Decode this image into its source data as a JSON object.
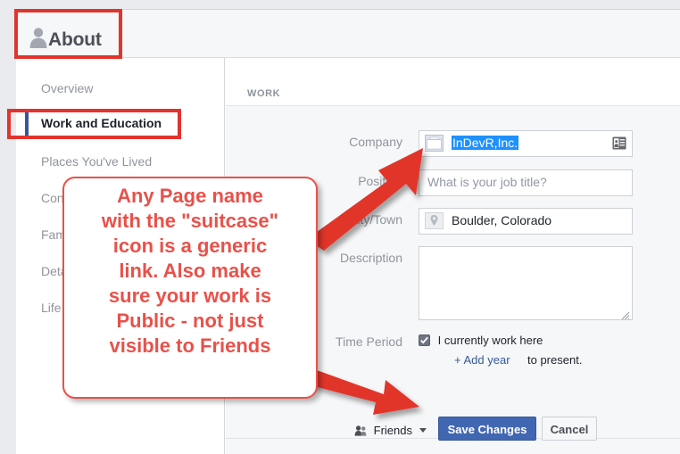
{
  "header": {
    "title": "About",
    "person_icon": "person-icon"
  },
  "sidebar": {
    "items": [
      {
        "label": "Overview",
        "active": false
      },
      {
        "label": "Work and Education",
        "active": true
      },
      {
        "label": "Places You've Lived",
        "active": false
      },
      {
        "label": "Contact and Basic Info",
        "active": false
      },
      {
        "label": "Family and Relationships",
        "active": false
      },
      {
        "label": "Details About You",
        "active": false
      },
      {
        "label": "Life Events",
        "active": false
      }
    ]
  },
  "main": {
    "section_title": "WORK",
    "fields": {
      "company": {
        "label": "Company",
        "value": "InDevR,Inc.",
        "selected": true,
        "left_icon": "suitcase-icon",
        "right_icon": "contact-card-icon"
      },
      "position": {
        "label": "Position",
        "value": "",
        "placeholder": "What is your job title?"
      },
      "city": {
        "label": "City/Town",
        "value": "Boulder, Colorado",
        "left_icon": "map-pin-icon"
      },
      "description": {
        "label": "Description",
        "value": "",
        "resize_handle": "resize-grip-icon"
      },
      "time_period": {
        "label": "Time Period",
        "checkbox_label": "I currently work here",
        "checked": true,
        "add_year_label": "+ Add year",
        "to_present_label": "to present."
      }
    },
    "footer": {
      "audience_label": "Friends",
      "audience_icon": "friends-icon",
      "caret_icon": "chevron-down-icon",
      "save_label": "Save Changes",
      "cancel_label": "Cancel"
    }
  },
  "annotations": {
    "callout_text": "Any Page name\nwith the \"suitcase\"\nicon is a generic\nlink.  Also make\nsure your work is\nPublic - not just\nvisible to Friends",
    "highlight_boxes": [
      {
        "name": "about-header-highlight"
      },
      {
        "name": "work-and-education-highlight"
      }
    ],
    "arrows": [
      {
        "name": "arrow-to-suitcase-icon"
      },
      {
        "name": "arrow-to-friends-selector"
      }
    ]
  },
  "colors": {
    "annotation_red": "#e2342c",
    "callout_red": "#e8514a",
    "fb_blue": "#4267b2",
    "link_blue": "#365899",
    "selection_blue": "#1e90ff"
  }
}
